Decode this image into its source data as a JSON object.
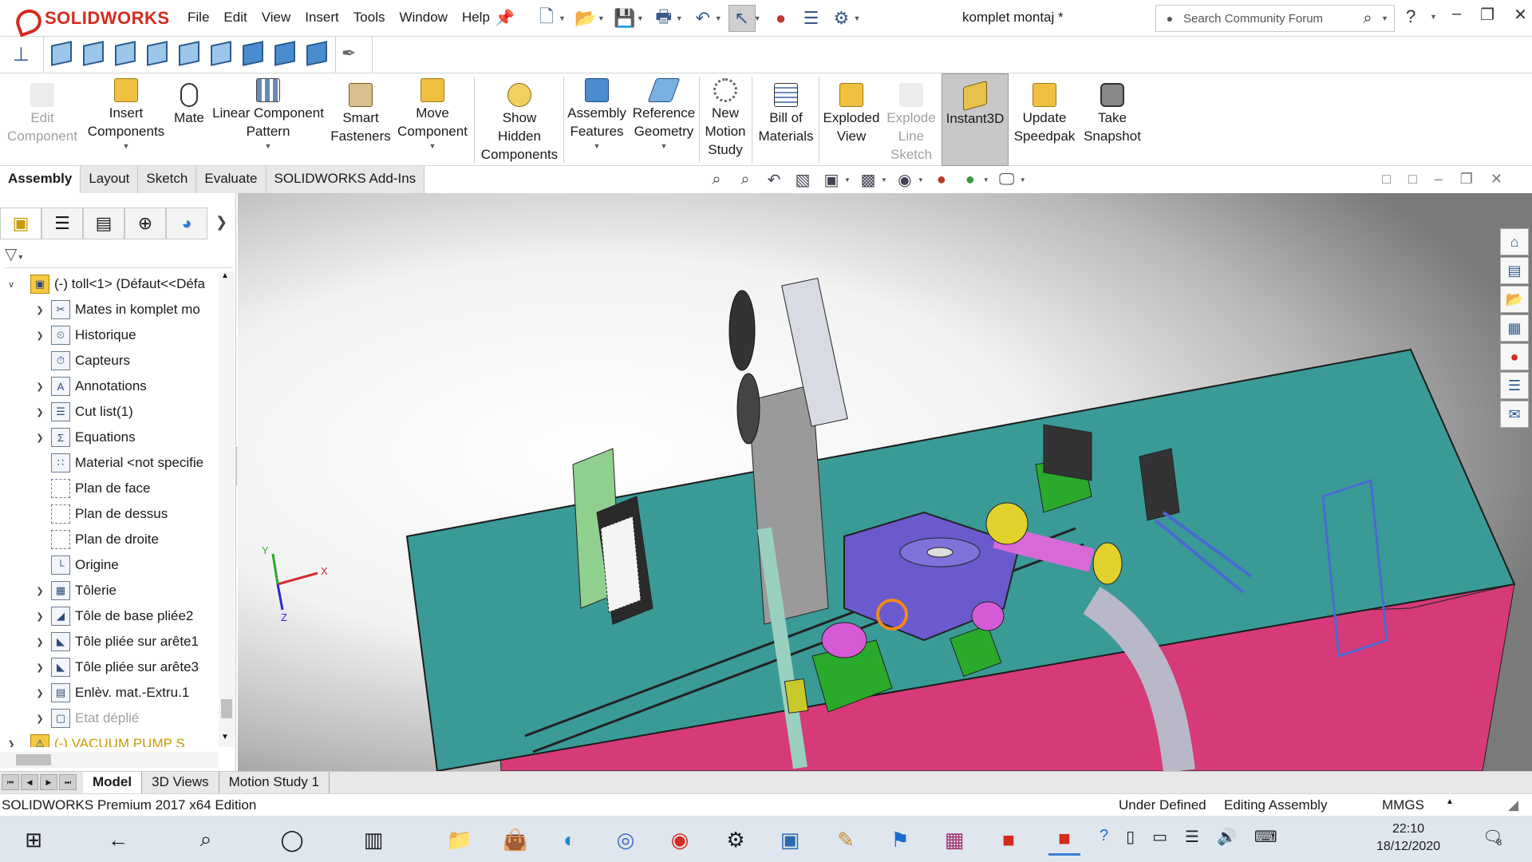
{
  "app": {
    "brand": "SOLIDWORKS",
    "menus": [
      "File",
      "Edit",
      "View",
      "Insert",
      "Tools",
      "Window",
      "Help"
    ],
    "document_title": "komplet montaj *",
    "search_placeholder": "Search Community Forum"
  },
  "command_manager": [
    {
      "label": "Edit\nComponent",
      "enabled": false,
      "icon": "edit-component-icon"
    },
    {
      "label": "Insert\nComponents",
      "enabled": true,
      "dropdown": true,
      "icon": "insert-components-icon"
    },
    {
      "label": "Mate",
      "enabled": true,
      "icon": "paperclip-icon"
    },
    {
      "label": "Linear Component\nPattern",
      "enabled": true,
      "dropdown": true,
      "icon": "linear-pattern-icon"
    },
    {
      "label": "Smart\nFasteners",
      "enabled": true,
      "icon": "smart-fasteners-icon"
    },
    {
      "label": "Move\nComponent",
      "enabled": true,
      "dropdown": true,
      "icon": "move-component-icon"
    },
    {
      "label": "Show\nHidden\nComponents",
      "enabled": true,
      "icon": "show-hidden-icon"
    },
    {
      "label": "Assembly\nFeatures",
      "enabled": true,
      "dropdown": true,
      "icon": "assembly-features-icon"
    },
    {
      "label": "Reference\nGeometry",
      "enabled": true,
      "dropdown": true,
      "icon": "reference-geometry-icon"
    },
    {
      "label": "New\nMotion\nStudy",
      "enabled": true,
      "icon": "motion-study-icon"
    },
    {
      "label": "Bill of\nMaterials",
      "enabled": true,
      "icon": "bill-of-materials-icon"
    },
    {
      "label": "Exploded\nView",
      "enabled": true,
      "icon": "exploded-view-icon"
    },
    {
      "label": "Explode\nLine\nSketch",
      "enabled": false,
      "icon": "explode-line-icon"
    },
    {
      "label": "Instant3D",
      "enabled": true,
      "active": true,
      "icon": "instant3d-icon"
    },
    {
      "label": "Update\nSpeedpak",
      "enabled": true,
      "icon": "speedpak-icon"
    },
    {
      "label": "Take\nSnapshot",
      "enabled": true,
      "icon": "camera-icon"
    }
  ],
  "tabs": [
    "Assembly",
    "Layout",
    "Sketch",
    "Evaluate",
    "SOLIDWORKS Add-Ins"
  ],
  "active_tab": "Assembly",
  "feature_tree": [
    {
      "label": "(-) toll<1> (Défaut<<Défa",
      "expander": "down",
      "icon": "assembly-icon",
      "level": 0
    },
    {
      "label": "Mates in komplet mo",
      "expander": "right",
      "icon": "mates-icon",
      "level": 1
    },
    {
      "label": "Historique",
      "expander": "right",
      "icon": "history-icon",
      "level": 1
    },
    {
      "label": "Capteurs",
      "expander": "",
      "icon": "sensors-icon",
      "level": 1
    },
    {
      "label": "Annotations",
      "expander": "right",
      "icon": "annotations-icon",
      "level": 1
    },
    {
      "label": "Cut list(1)",
      "expander": "right",
      "icon": "cut-list-icon",
      "level": 1
    },
    {
      "label": "Equations",
      "expander": "right",
      "icon": "equations-icon",
      "level": 1
    },
    {
      "label": "Material <not specifie",
      "expander": "",
      "icon": "material-icon",
      "level": 1
    },
    {
      "label": "Plan de face",
      "expander": "",
      "icon": "plane-icon",
      "level": 1
    },
    {
      "label": "Plan de dessus",
      "expander": "",
      "icon": "plane-icon",
      "level": 1
    },
    {
      "label": "Plan de droite",
      "expander": "",
      "icon": "plane-icon",
      "level": 1
    },
    {
      "label": "Origine",
      "expander": "",
      "icon": "origin-icon",
      "level": 1
    },
    {
      "label": "Tôlerie",
      "expander": "right",
      "icon": "sheet-metal-icon",
      "level": 1
    },
    {
      "label": "Tôle de base pliée2",
      "expander": "right",
      "icon": "base-flange-icon",
      "level": 1
    },
    {
      "label": "Tôle pliée sur arête1",
      "expander": "right",
      "icon": "edge-flange-icon",
      "level": 1
    },
    {
      "label": "Tôle pliée sur arête3",
      "expander": "right",
      "icon": "edge-flange-icon",
      "level": 1
    },
    {
      "label": "Enlèv. mat.-Extru.1",
      "expander": "right",
      "icon": "cut-extrude-icon",
      "level": 1
    },
    {
      "label": "Etat déplié",
      "expander": "right",
      "icon": "flat-pattern-icon",
      "level": 1,
      "dim": true
    },
    {
      "label": "(-) VACUUM PUMP S",
      "expander": "right",
      "icon": "warning-icon",
      "level": 0,
      "warn": true
    }
  ],
  "bottom_tabs": [
    "Model",
    "3D Views",
    "Motion Study 1"
  ],
  "active_bottom_tab": "Model",
  "status": {
    "edition": "SOLIDWORKS Premium 2017 x64 Edition",
    "state": "Under Defined",
    "mode": "Editing Assembly",
    "units": "MMGS"
  },
  "triad": {
    "x": "X",
    "y": "Y",
    "z": "Z"
  },
  "taskbar": {
    "time": "22:10",
    "date": "18/12/2020",
    "notifications": "8"
  },
  "colors": {
    "brand_red": "#d52b1e",
    "table_teal": "#3a9a96",
    "frame_pink": "#d63a78",
    "part_purple": "#6a5acd",
    "part_green": "#2aaa2a"
  }
}
